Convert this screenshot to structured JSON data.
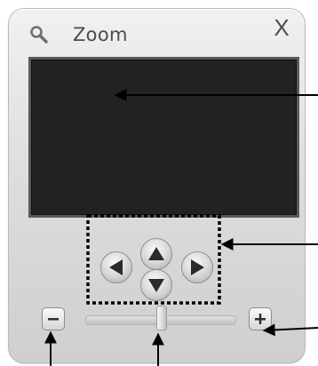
{
  "window": {
    "title": "Zoom",
    "close_label": "X",
    "title_icon": "magnifier-icon"
  },
  "controls": {
    "pan_icons": [
      "pan-up-icon",
      "pan-left-icon",
      "pan-right-icon",
      "pan-down-icon"
    ],
    "zoom_out_icon": "minus-icon",
    "zoom_in_icon": "plus-icon"
  },
  "zoom_slider": {
    "level_fraction": 0.5
  },
  "colors": {
    "view_background": "#222222",
    "annotation": "#000000",
    "panel": "#dedede"
  }
}
